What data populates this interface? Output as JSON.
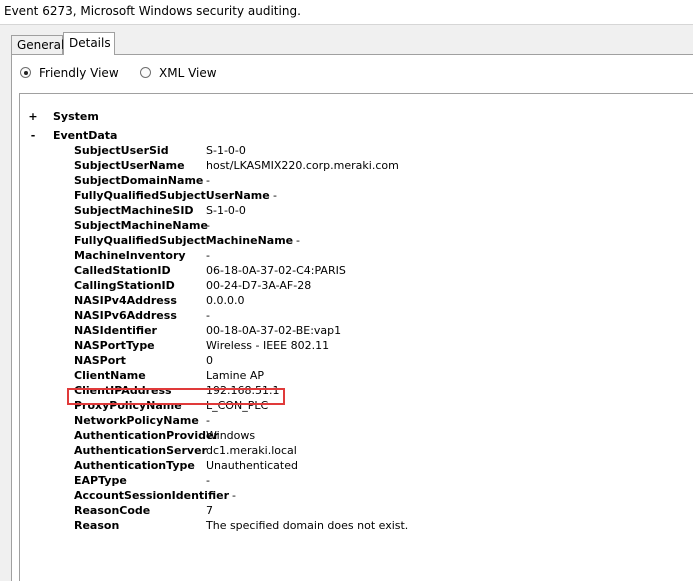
{
  "window": {
    "title": "Event 6273, Microsoft Windows security auditing."
  },
  "tabs": [
    {
      "label": "General"
    },
    {
      "label": "Details"
    }
  ],
  "view_options": {
    "friendly": "Friendly View",
    "xml": "XML View"
  },
  "tree": {
    "system": {
      "toggle": "+",
      "label": "System"
    },
    "eventdata": {
      "toggle": "-",
      "label": "EventData"
    }
  },
  "fields": [
    {
      "name": "SubjectUserSid",
      "value": "S-1-0-0"
    },
    {
      "name": "SubjectUserName",
      "value": "host/LKASMIX220.corp.meraki.com"
    },
    {
      "name": "SubjectDomainName",
      "value": "-"
    },
    {
      "name": "FullyQualifiedSubjectUserName",
      "value": "-"
    },
    {
      "name": "SubjectMachineSID",
      "value": "S-1-0-0"
    },
    {
      "name": "SubjectMachineName",
      "value": "-"
    },
    {
      "name": "FullyQualifiedSubjectMachineName",
      "value": "-"
    },
    {
      "name": "MachineInventory",
      "value": "-"
    },
    {
      "name": "CalledStationID",
      "value": "06-18-0A-37-02-C4:PARIS"
    },
    {
      "name": "CallingStationID",
      "value": "00-24-D7-3A-AF-28"
    },
    {
      "name": "NASIPv4Address",
      "value": "0.0.0.0"
    },
    {
      "name": "NASIPv6Address",
      "value": "-"
    },
    {
      "name": "NASIdentifier",
      "value": "00-18-0A-37-02-BE:vap1"
    },
    {
      "name": "NASPortType",
      "value": "Wireless - IEEE 802.11"
    },
    {
      "name": "NASPort",
      "value": "0"
    },
    {
      "name": "ClientName",
      "value": "Lamine AP"
    },
    {
      "name": "ClientIPAddress",
      "value": "192.168.51.1"
    },
    {
      "name": "ProxyPolicyName",
      "value": "L_CON_PLC"
    },
    {
      "name": "NetworkPolicyName",
      "value": "-"
    },
    {
      "name": "AuthenticationProvider",
      "value": "Windows"
    },
    {
      "name": "AuthenticationServer",
      "value": "dc1.meraki.local"
    },
    {
      "name": "AuthenticationType",
      "value": "Unauthenticated"
    },
    {
      "name": "EAPType",
      "value": "-"
    },
    {
      "name": "AccountSessionIdentifier",
      "value": "-"
    },
    {
      "name": "ReasonCode",
      "value": "7"
    },
    {
      "name": "Reason",
      "value": "The specified domain does not exist."
    }
  ],
  "colors": {
    "highlight": "#e03a3a",
    "border": "#a0a0a0"
  }
}
